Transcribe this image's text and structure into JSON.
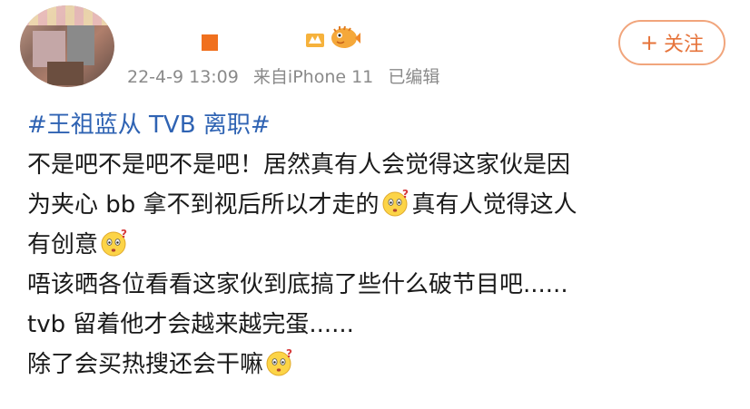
{
  "post": {
    "meta": {
      "time": "22-4-9 13:09",
      "source": "来自iPhone 11",
      "edited": "已编辑"
    },
    "follow_label": "关注",
    "follow_plus": "+",
    "topic": "#王祖蓝从 TVB 离职#",
    "lines": [
      "不是吧不是吧不是吧！居然真有人会觉得这家伙是因",
      "为夹心 bb 拿不到视后所以才走的",
      "真有人觉得这人",
      "有创意",
      "唔该晒各位看看这家伙到底搞了些什么破节目吧......",
      "tvb 留着他才会越来越完蛋......",
      "除了会买热搜还会干嘛"
    ],
    "icons": {
      "avatar": "blurred-avatar",
      "vip": "vip-badge-icon",
      "fish": "pufferfish-icon",
      "emoji": "thinking-face-emoji"
    },
    "colors": {
      "topic": "#2f63b3",
      "follow": "#e6733a",
      "meta": "#8a8a8a"
    }
  }
}
